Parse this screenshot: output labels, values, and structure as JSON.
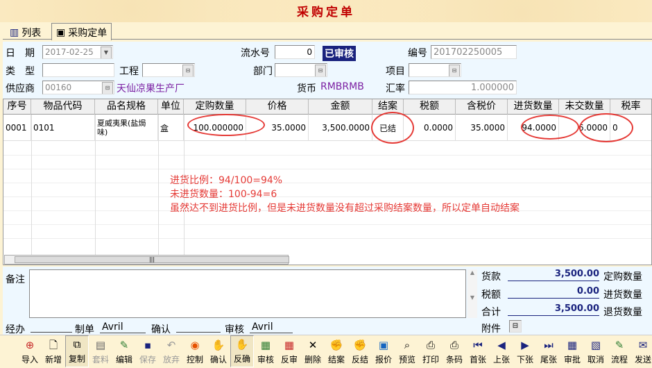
{
  "window": {
    "title": "采购定单"
  },
  "tabs": [
    {
      "label": "列表"
    },
    {
      "label": "采购定单"
    }
  ],
  "form": {
    "date_label": "日　期",
    "date_value": "2017-02-25",
    "serial_label": "流水号",
    "serial_value": "0",
    "status_badge": "已审核",
    "number_label": "编号",
    "number_value": "201702250005",
    "type_label": "类　型",
    "type_value": "",
    "project_label": "工程",
    "project_value": "",
    "dept_label": "部门",
    "dept_value": "",
    "item_label": "项目",
    "item_value": "",
    "supplier_label": "供应商",
    "supplier_code": "00160",
    "supplier_name": "天仙凉果生产厂",
    "currency_label": "货币",
    "currency_value": "RMBRMB",
    "rate_label": "汇率",
    "rate_value": "1.000000"
  },
  "grid": {
    "columns": [
      "序号",
      "物品代码",
      "品名规格",
      "单位",
      "定购数量",
      "价格",
      "金额",
      "结案",
      "税额",
      "含税价",
      "进货数量",
      "未交数量",
      "税率"
    ],
    "rows": [
      {
        "seq": "0001",
        "code": "0101",
        "name": "夏威夷果(盐焗味)",
        "unit": "盒",
        "qty": "100.000000",
        "price": "35.0000",
        "amount": "3,500.0000",
        "closed": "已结",
        "tax": "0.0000",
        "taxprice": "35.0000",
        "received": "94.0000",
        "undelivered": "6.0000",
        "taxrate": "0"
      }
    ]
  },
  "annotation": {
    "line1": "进货比例：94/100=94%",
    "line2": "未进货数量：100-94=6",
    "line3": "虽然达不到进货比例，但是未进货数量没有超过采购结案数量，所以定单自动结案"
  },
  "bottom": {
    "memo_label": "备注",
    "memo_value": "",
    "goods_label": "货款",
    "goods_value": "3,500.00",
    "tax_label": "税额",
    "tax_value": "0.00",
    "total_label": "合计",
    "total_value": "3,500.00",
    "ordered_label": "定购数量",
    "received_label": "进货数量",
    "returned_label": "退货数量",
    "attach_label": "附件",
    "handler_label": "经办",
    "handler_value": "",
    "maker_label": "制单",
    "maker_value": "Avril",
    "confirm_label": "确认",
    "confirm_value": "",
    "audit_label": "审核",
    "audit_value": "Avril"
  },
  "toolbar": [
    {
      "label": "导入",
      "icon": "import-icon"
    },
    {
      "label": "新增",
      "icon": "new-doc-icon"
    },
    {
      "label": "复制",
      "icon": "copy-icon"
    },
    {
      "label": "套料",
      "icon": "kit-icon"
    },
    {
      "label": "编辑",
      "icon": "edit-icon"
    },
    {
      "label": "保存",
      "icon": "save-icon"
    },
    {
      "label": "放弃",
      "icon": "undo-icon"
    },
    {
      "label": "控制",
      "icon": "control-icon"
    },
    {
      "label": "确认",
      "icon": "confirm-icon"
    },
    {
      "label": "反确",
      "icon": "unconfirm-icon"
    },
    {
      "label": "审核",
      "icon": "audit-icon"
    },
    {
      "label": "反审",
      "icon": "unaudit-icon"
    },
    {
      "label": "删除",
      "icon": "delete-icon"
    },
    {
      "label": "结案",
      "icon": "close-case-icon"
    },
    {
      "label": "反结",
      "icon": "reopen-icon"
    },
    {
      "label": "报价",
      "icon": "quote-icon"
    },
    {
      "label": "预览",
      "icon": "preview-icon"
    },
    {
      "label": "打印",
      "icon": "print-icon"
    },
    {
      "label": "条码",
      "icon": "barcode-print-icon"
    },
    {
      "label": "首张",
      "icon": "first-icon"
    },
    {
      "label": "上张",
      "icon": "prev-icon"
    },
    {
      "label": "下张",
      "icon": "next-icon"
    },
    {
      "label": "尾张",
      "icon": "last-icon"
    },
    {
      "label": "审批",
      "icon": "approve-icon"
    },
    {
      "label": "取消",
      "icon": "cancel-icon"
    },
    {
      "label": "流程",
      "icon": "flow-icon"
    },
    {
      "label": "发送",
      "icon": "send-icon"
    }
  ]
}
